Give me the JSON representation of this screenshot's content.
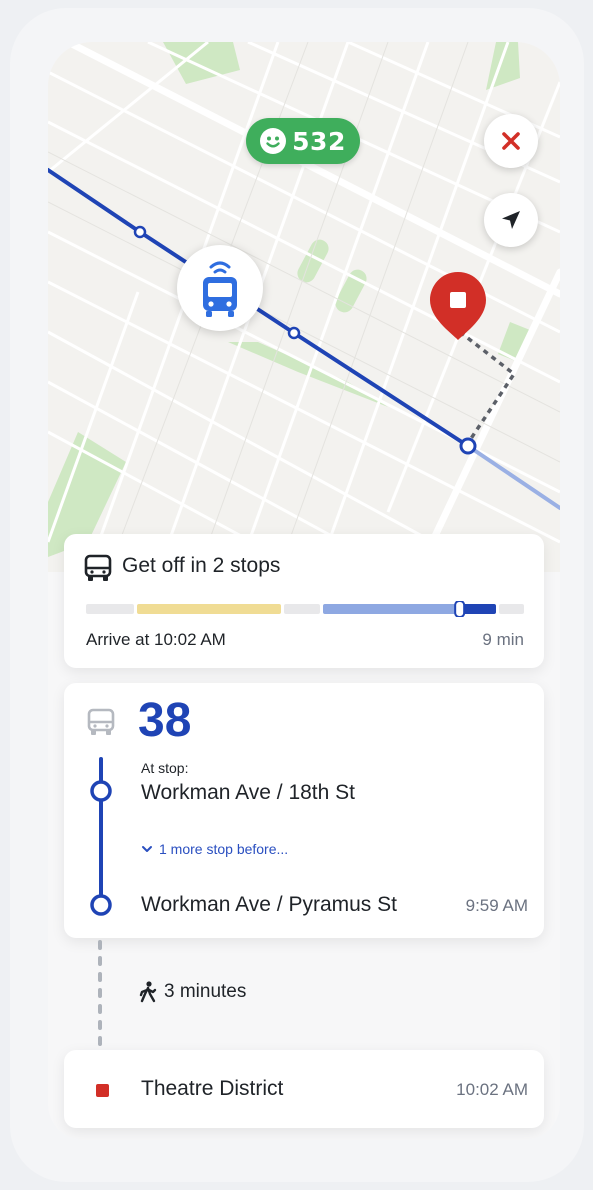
{
  "map": {
    "rider_count": "532",
    "icons": {
      "rider": "smiley-face-icon",
      "close": "close-icon",
      "locate": "navigation-arrow-icon",
      "vehicle": "live-bus-icon",
      "destination": "destination-pin-icon"
    },
    "colors": {
      "route_line": "#1f44b5",
      "route_line_future": "#9ab0e4",
      "park": "#cfe8c3",
      "pin": "#d22f27",
      "chip": "#3fae5c"
    }
  },
  "trip_summary": {
    "title": "Get off in 2 stops",
    "arrive_text": "Arrive at 10:02 AM",
    "duration": "9 min",
    "progress_fraction": 0.79
  },
  "route": {
    "number": "38",
    "at_stop_label": "At stop:",
    "current_stop": "Workman Ave / 18th St",
    "more_stops": "1 more stop before...",
    "final_stop": "Workman Ave / Pyramus St",
    "final_stop_time": "9:59 AM"
  },
  "walk": {
    "text": "3 minutes"
  },
  "destination": {
    "name": "Theatre District",
    "time": "10:02 AM"
  }
}
